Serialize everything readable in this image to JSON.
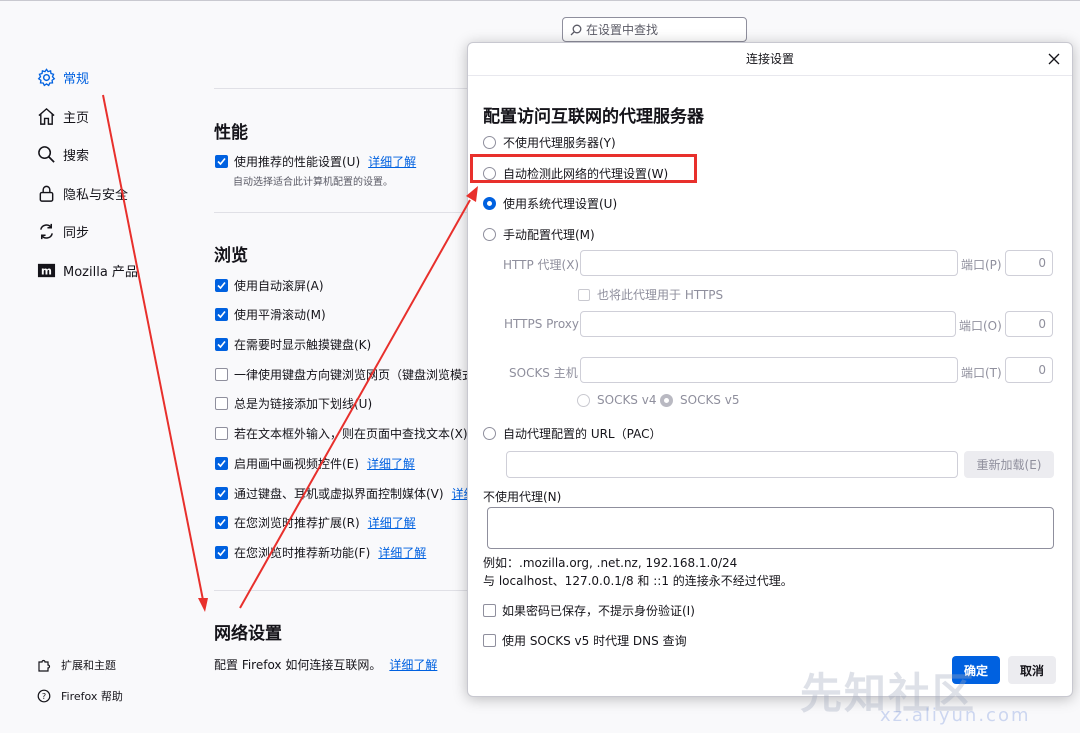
{
  "search": {
    "placeholder": "在设置中查找"
  },
  "sidebar": {
    "items": [
      {
        "label": "常规",
        "icon": "gear-icon",
        "active": true
      },
      {
        "label": "主页",
        "icon": "home-icon"
      },
      {
        "label": "搜索",
        "icon": "search-icon"
      },
      {
        "label": "隐私与安全",
        "icon": "lock-icon"
      },
      {
        "label": "同步",
        "icon": "sync-icon"
      },
      {
        "label": "Mozilla 产品",
        "icon": "mozilla-icon"
      }
    ],
    "footer": [
      {
        "label": "扩展和主题",
        "icon": "puzzle-icon"
      },
      {
        "label": "Firefox 帮助",
        "icon": "help-icon"
      }
    ]
  },
  "main": {
    "performance": {
      "title": "性能",
      "option": "使用推荐的性能设置(U)",
      "link": "详细了解",
      "subtext": "自动选择适合此计算机配置的设置。"
    },
    "browsing": {
      "title": "浏览",
      "options": [
        {
          "label": "使用自动滚屏(A)",
          "checked": true
        },
        {
          "label": "使用平滑滚动(M)",
          "checked": true
        },
        {
          "label": "在需要时显示触摸键盘(K)",
          "checked": true
        },
        {
          "label": "一律使用键盘方向键浏览网页（键盘浏览模式",
          "checked": false
        },
        {
          "label": "总是为链接添加下划线(U)",
          "checked": false
        },
        {
          "label": "若在文本框外输入，则在页面中查找文本(X)",
          "checked": false
        },
        {
          "label": "启用画中画视频控件(E)",
          "checked": true,
          "link": "详细了解"
        },
        {
          "label": "通过键盘、耳机或虚拟界面控制媒体(V)",
          "checked": true,
          "link": "详细"
        },
        {
          "label": "在您浏览时推荐扩展(R)",
          "checked": true,
          "link": "详细了解"
        },
        {
          "label": "在您浏览时推荐新功能(F)",
          "checked": true,
          "link": "详细了解"
        }
      ]
    },
    "network": {
      "title": "网络设置",
      "desc": "配置 Firefox 如何连接互联网。",
      "link": "详细了解"
    }
  },
  "dialog": {
    "title": "连接设置",
    "heading": "配置访问互联网的代理服务器",
    "radios": [
      {
        "label": "不使用代理服务器(Y)",
        "selected": false
      },
      {
        "label": "自动检测此网络的代理设置(W)",
        "selected": false
      },
      {
        "label": "使用系统代理设置(U)",
        "selected": true
      },
      {
        "label": "手动配置代理(M)",
        "selected": false
      }
    ],
    "http_label": "HTTP 代理(X)",
    "https_label": "HTTPS Proxy",
    "socks_label": "SOCKS 主机",
    "port_label_http": "端口(P)",
    "port_label_https": "端口(O)",
    "port_label_socks": "端口(T)",
    "port_value": "0",
    "also_https": "也将此代理用于 HTTPS",
    "socks_v4": "SOCKS v4",
    "socks_v5": "SOCKS v5",
    "pac_label": "自动代理配置的 URL（PAC）",
    "reload": "重新加载(E)",
    "noproxy_label": "不使用代理(N)",
    "hint1": "例如：.mozilla.org, .net.nz, 192.168.1.0/24",
    "hint2": "与 localhost、127.0.0.1/8 和 ::1 的连接永不经过代理。",
    "cb_auth": "如果密码已保存，不提示身份验证(I)",
    "cb_dns": "使用 SOCKS v5 时代理 DNS 查询",
    "ok": "确定",
    "cancel": "取消"
  },
  "watermark": {
    "main": "先知社区",
    "sub": "xz.aliyun.com"
  },
  "colors": {
    "accent": "#0061e0",
    "annotation": "#e8302c"
  }
}
